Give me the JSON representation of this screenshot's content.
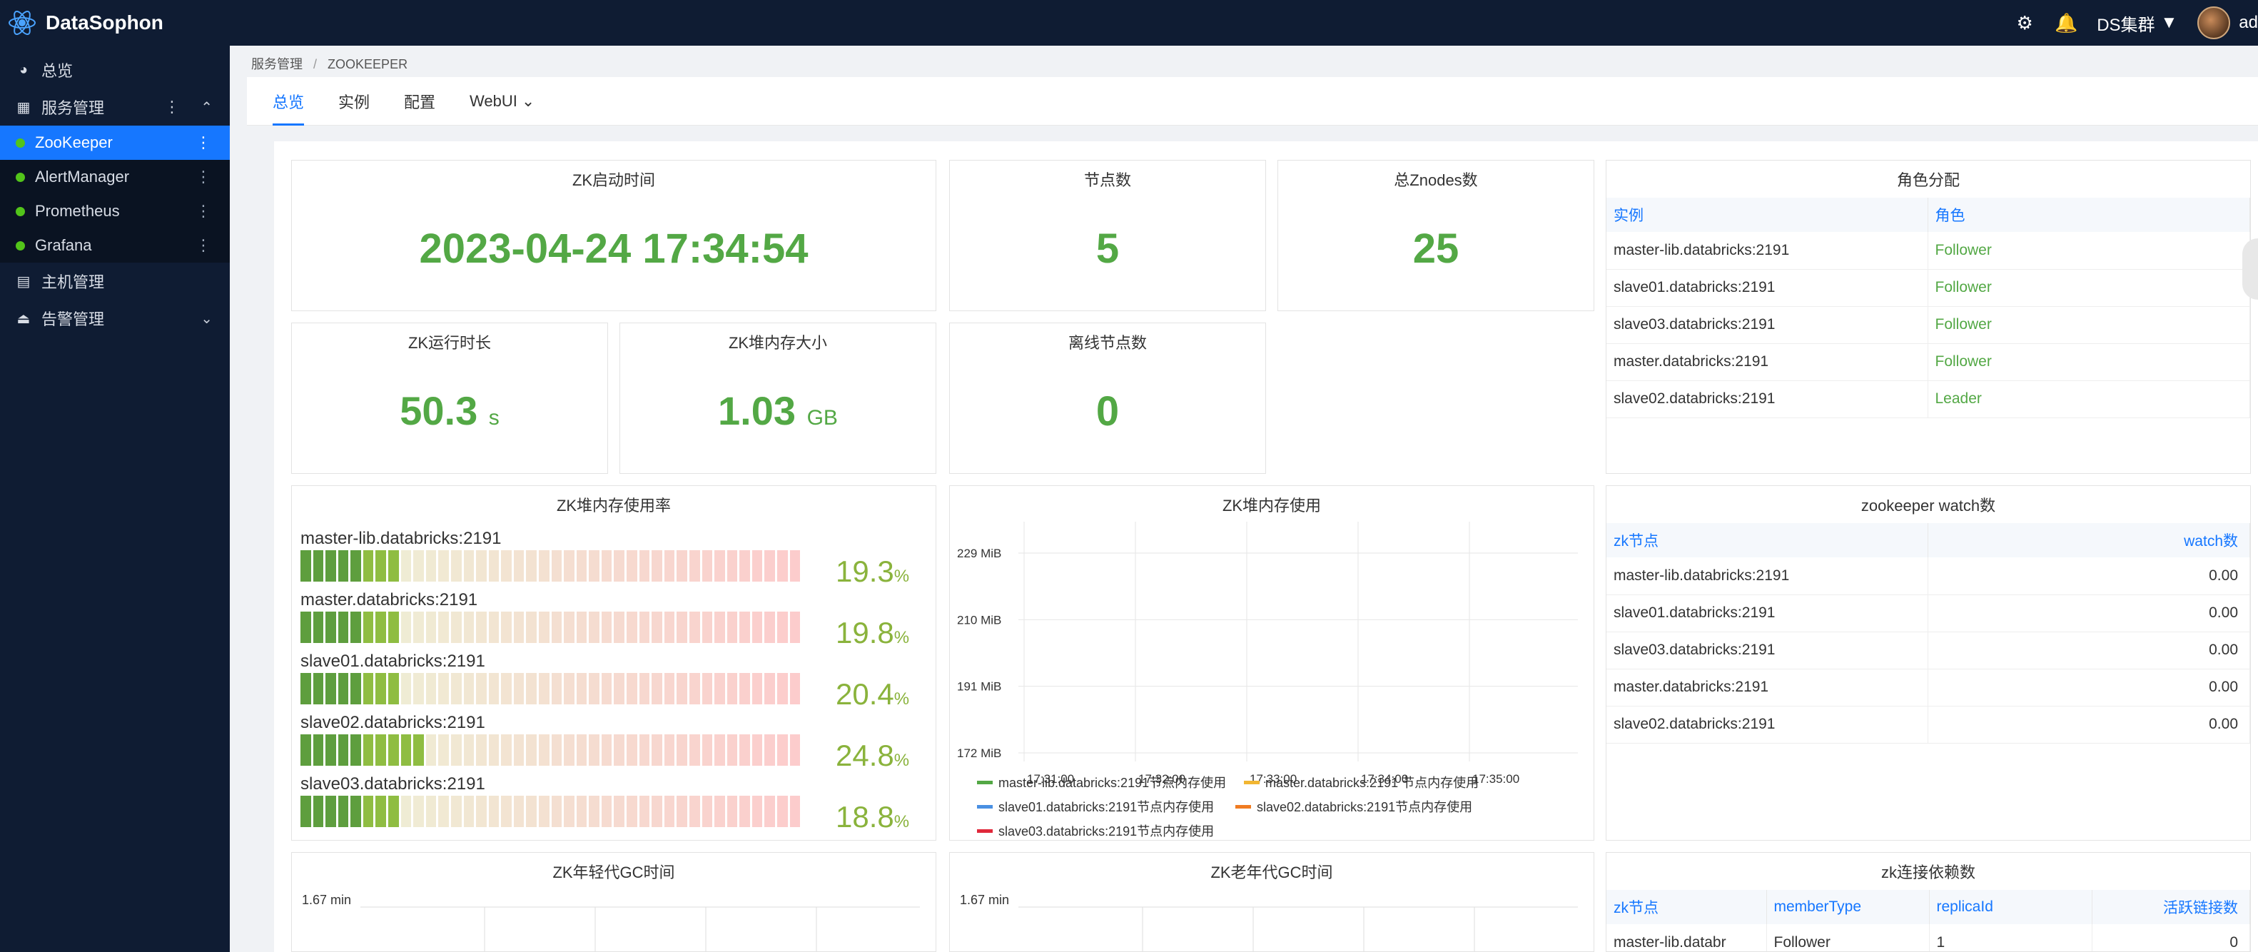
{
  "app": {
    "title": "DataSophon"
  },
  "topbar": {
    "cluster": "DS集群",
    "user": "ad"
  },
  "sidebar": {
    "overview": "总览",
    "service_mgmt": "服务管理",
    "services": [
      "ZooKeeper",
      "AlertManager",
      "Prometheus",
      "Grafana"
    ],
    "host_mgmt": "主机管理",
    "alert_mgmt": "告警管理"
  },
  "breadcrumb": {
    "parent": "服务管理",
    "current": "ZOOKEEPER"
  },
  "tabs": [
    "总览",
    "实例",
    "配置",
    "WebUI"
  ],
  "cards": {
    "start_time": {
      "title": "ZK启动时间",
      "value": "2023-04-24 17:34:54"
    },
    "node_count": {
      "title": "节点数",
      "value": "5"
    },
    "znodes": {
      "title": "总Znodes数",
      "value": "25"
    },
    "uptime": {
      "title": "ZK运行时长",
      "value": "50.3",
      "unit": "s"
    },
    "heap_size": {
      "title": "ZK堆内存大小",
      "value": "1.03",
      "unit": "GB"
    },
    "offline": {
      "title": "离线节点数",
      "value": "0"
    }
  },
  "roles": {
    "title": "角色分配",
    "headers": [
      "实例",
      "角色"
    ],
    "rows": [
      [
        "master-lib.databricks:2191",
        "Follower"
      ],
      [
        "slave01.databricks:2191",
        "Follower"
      ],
      [
        "slave03.databricks:2191",
        "Follower"
      ],
      [
        "master.databricks:2191",
        "Follower"
      ],
      [
        "slave02.databricks:2191",
        "Leader"
      ]
    ]
  },
  "heap_usage": {
    "title": "ZK堆内存使用率",
    "items": [
      {
        "name": "master-lib.databricks:2191",
        "pct": 19.3
      },
      {
        "name": "master.databricks:2191",
        "pct": 19.8
      },
      {
        "name": "slave01.databricks:2191",
        "pct": 20.4
      },
      {
        "name": "slave02.databricks:2191",
        "pct": 24.8
      },
      {
        "name": "slave03.databricks:2191",
        "pct": 18.8
      }
    ],
    "pct_unit": "%"
  },
  "heap_chart": {
    "title": "ZK堆内存使用",
    "y_ticks": [
      "229 MiB",
      "210 MiB",
      "191 MiB",
      "172 MiB"
    ],
    "x_ticks": [
      "17:31:00",
      "17:32:00",
      "17:33:00",
      "17:34:00",
      "17:35:00"
    ],
    "legend": [
      {
        "name": "master-lib.databricks:2191节点内存使用",
        "color": "#53a845"
      },
      {
        "name": "master.databricks:2191 节点内存使用",
        "color": "#f2b632"
      },
      {
        "name": "slave01.databricks:2191节点内存使用",
        "color": "#4a90e2"
      },
      {
        "name": "slave02.databricks:2191节点内存使用",
        "color": "#f07c22"
      },
      {
        "name": "slave03.databricks:2191节点内存使用",
        "color": "#e0283b"
      }
    ]
  },
  "watch": {
    "title": "zookeeper watch数",
    "headers": [
      "zk节点",
      "watch数"
    ],
    "rows": [
      [
        "master-lib.databricks:2191",
        "0.00"
      ],
      [
        "slave01.databricks:2191",
        "0.00"
      ],
      [
        "slave03.databricks:2191",
        "0.00"
      ],
      [
        "master.databricks:2191",
        "0.00"
      ],
      [
        "slave02.databricks:2191",
        "0.00"
      ]
    ]
  },
  "young_gc": {
    "title": "ZK年轻代GC时间",
    "y_tick": "1.67 min"
  },
  "old_gc": {
    "title": "ZK老年代GC时间",
    "y_tick": "1.67 min"
  },
  "conn": {
    "title": "zk连接依赖数",
    "headers": [
      "zk节点",
      "memberType",
      "replicaId",
      "活跃链接数"
    ],
    "row": [
      "master-lib.databr",
      "Follower",
      "1",
      "0"
    ]
  },
  "chart_data": {
    "type": "line",
    "title": "ZK堆内存使用",
    "x": [
      "17:31:00",
      "17:32:00",
      "17:33:00",
      "17:34:00",
      "17:35:00"
    ],
    "ylabel": "",
    "series": [
      {
        "name": "master-lib.databricks:2191节点内存使用",
        "values": []
      },
      {
        "name": "master.databricks:2191 节点内存使用",
        "values": []
      },
      {
        "name": "slave01.databricks:2191节点内存使用",
        "values": []
      },
      {
        "name": "slave02.databricks:2191节点内存使用",
        "values": []
      },
      {
        "name": "slave03.databricks:2191节点内存使用",
        "values": []
      }
    ]
  }
}
